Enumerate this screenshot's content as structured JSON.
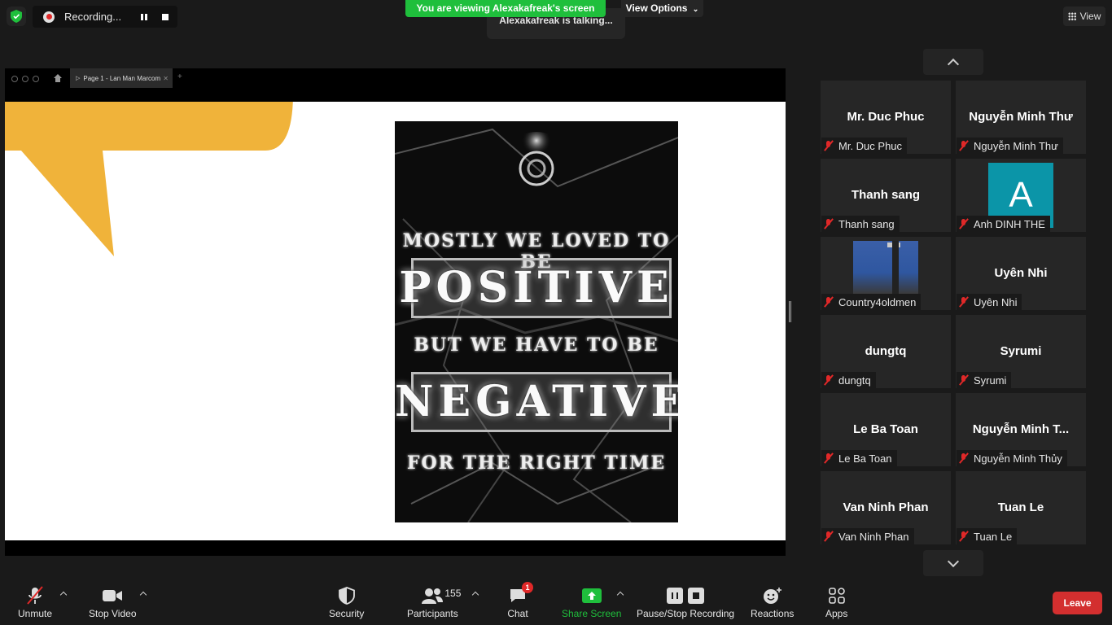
{
  "top": {
    "recording_label": "Recording...",
    "talking": "Alexakafreak is talking...",
    "viewing_banner": "You are viewing Alexakafreak's screen",
    "view_options": "View Options",
    "view_label": "View"
  },
  "share": {
    "tab_title": "Page 1 - Lan Man Marcom",
    "accent_color": "#f0b33a",
    "poster": {
      "line1": "MOSTLY WE LOVED TO BE",
      "line2": "POSITIVE",
      "line3": "BUT WE HAVE TO BE",
      "line4": "NEGATIVE",
      "line5": "FOR THE RIGHT TIME"
    }
  },
  "gallery": {
    "tiles": [
      {
        "name": "Mr. Duc Phuc",
        "label": "Mr. Duc Phuc"
      },
      {
        "name": "Nguyễn Minh Thư",
        "label": "Nguyễn Minh Thư"
      },
      {
        "name": "Thanh sang",
        "label": "Thanh sang"
      },
      {
        "avatar": "A",
        "label": "Anh DINH THE"
      },
      {
        "label": "Country4oldmen"
      },
      {
        "name": "Uyên Nhi",
        "label": "Uyên Nhi"
      },
      {
        "name": "dungtq",
        "label": "dungtq"
      },
      {
        "name": "Syrumi",
        "label": "Syrumi"
      },
      {
        "name": "Le Ba Toan",
        "label": "Le Ba Toan"
      },
      {
        "name": "Nguyễn  Minh  T...",
        "label": "Nguyễn Minh Thủy"
      },
      {
        "name": "Van Ninh Phan",
        "label": "Van Ninh Phan"
      },
      {
        "name": "Tuan Le",
        "label": "Tuan Le"
      }
    ]
  },
  "toolbar": {
    "unmute": "Unmute",
    "stop_video": "Stop Video",
    "security": "Security",
    "participants": "Participants",
    "participant_count": "155",
    "chat": "Chat",
    "chat_badge": "1",
    "share_screen": "Share Screen",
    "recording": "Pause/Stop Recording",
    "reactions": "Reactions",
    "apps": "Apps",
    "leave": "Leave"
  },
  "colors": {
    "share_green": "#1fbf3c",
    "leave_red": "#d32f2f",
    "mute_red": "#e02828",
    "avatar_teal": "#0b95a8"
  }
}
